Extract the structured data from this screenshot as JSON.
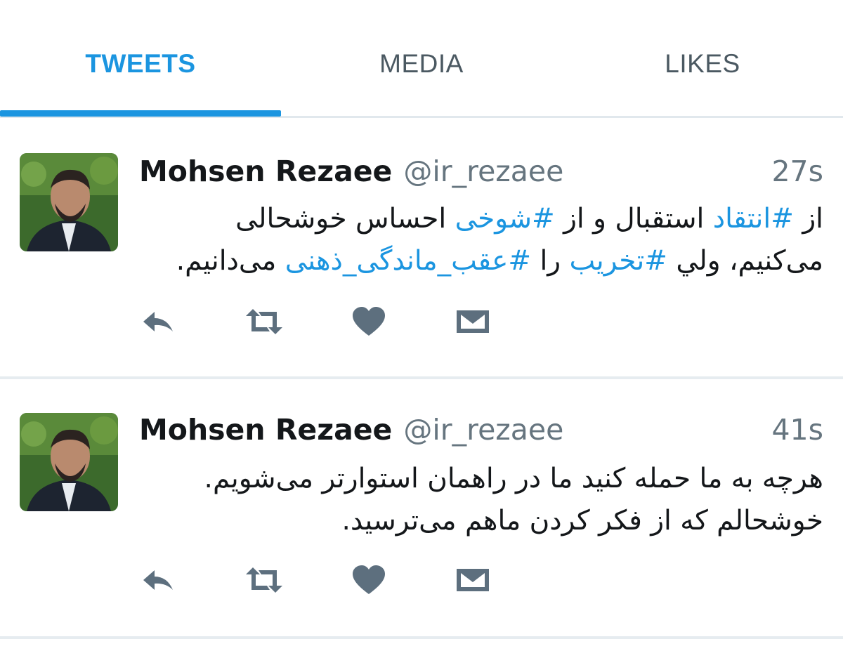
{
  "tabs": [
    {
      "label": "TWEETS",
      "active": true
    },
    {
      "label": "MEDIA",
      "active": false
    },
    {
      "label": "LIKES",
      "active": false
    }
  ],
  "colors": {
    "accent": "#1b95e0",
    "text": "#14171a",
    "muted": "#66757f",
    "action": "#5d6f7e"
  },
  "tweets": [
    {
      "author_name": "Mohsen Rezaee",
      "handle": "@ir_rezaee",
      "time": "27s",
      "text_parts": [
        {
          "t": "از "
        },
        {
          "t": "#انتقاد",
          "tag": true
        },
        {
          "t": " استقبال و از "
        },
        {
          "t": "#شوخی",
          "tag": true
        },
        {
          "t": " احساس خوشحالی می‌کنیم، ولي "
        },
        {
          "t": "#تخریب",
          "tag": true
        },
        {
          "t": " را "
        },
        {
          "t": "#عقب_ماندگی_ذهنی",
          "tag": true
        },
        {
          "t": " می‌دانیم."
        }
      ],
      "actions": [
        "reply-icon",
        "retweet-icon",
        "like-icon",
        "message-icon"
      ]
    },
    {
      "author_name": "Mohsen Rezaee",
      "handle": "@ir_rezaee",
      "time": "41s",
      "text_parts": [
        {
          "t": "هرچه به ما حمله کنید ما در راهمان استوارتر می‌شویم. خوشحالم که از فکر کردن ماهم می‌ترسید."
        }
      ],
      "actions": [
        "reply-icon",
        "retweet-icon",
        "like-icon",
        "message-icon"
      ]
    }
  ]
}
